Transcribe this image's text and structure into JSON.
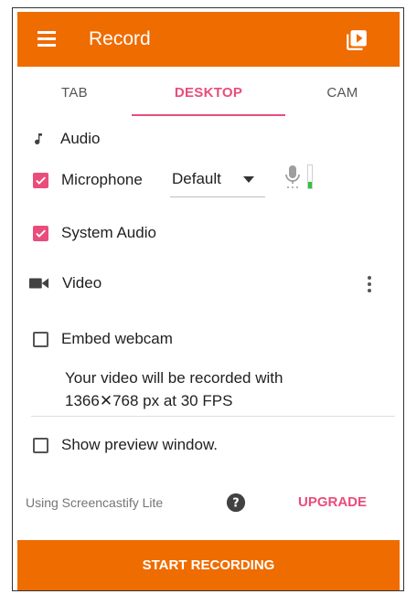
{
  "header": {
    "title": "Record",
    "menu_icon": "hamburger-menu-icon",
    "library_icon": "video-library-icon"
  },
  "tabs": [
    {
      "label": "TAB",
      "active": false
    },
    {
      "label": "DESKTOP",
      "active": true
    },
    {
      "label": "CAM",
      "active": false
    }
  ],
  "audio": {
    "section_label": "Audio",
    "microphone": {
      "label": "Microphone",
      "checked": true,
      "selected": "Default",
      "level": 0.3
    },
    "system_audio": {
      "label": "System Audio",
      "checked": true
    }
  },
  "video": {
    "section_label": "Video",
    "embed_webcam": {
      "label": "Embed webcam",
      "checked": false
    },
    "info_line1": "Your video will be recorded with",
    "info_line2": "1366✕768 px at 30 FPS",
    "preview": {
      "label": "Show preview window.",
      "checked": false
    }
  },
  "footer": {
    "lite_text": "Using Screencastify Lite",
    "upgrade_label": "UPGRADE",
    "start_label": "START RECORDING"
  },
  "colors": {
    "brand_orange": "#ef6c00",
    "accent_pink": "#e94d7b",
    "level_green": "#2ec43a"
  }
}
